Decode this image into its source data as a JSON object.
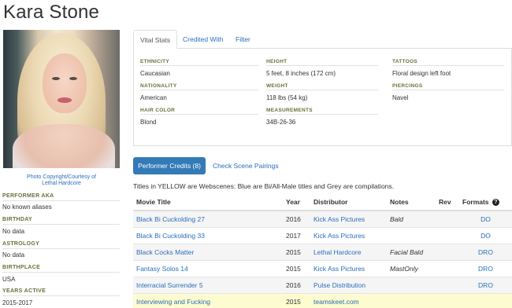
{
  "performer": {
    "name": "Kara Stone",
    "photo_credit_line1": "Photo Copyright/Courtesy of",
    "photo_credit_line2": "Lethal Hardcore"
  },
  "sidebar": [
    {
      "label": "PERFORMER AKA",
      "value": "No known aliases"
    },
    {
      "label": "BIRTHDAY",
      "value": "No data"
    },
    {
      "label": "ASTROLOGY",
      "value": "No data"
    },
    {
      "label": "BIRTHPLACE",
      "value": "USA"
    },
    {
      "label": "YEARS ACTIVE",
      "value": "2015-2017"
    }
  ],
  "tabs": [
    "Vital Stats",
    "Credited With",
    "Filter"
  ],
  "vital_stats": {
    "ethnicity_label": "ETHNICITY",
    "ethnicity": "Caucasian",
    "nationality_label": "NATIONALITY",
    "nationality": "American",
    "hair_label": "HAIR COLOR",
    "hair": "Blond",
    "height_label": "HEIGHT",
    "height": "5 feet, 8 inches (172 cm)",
    "weight_label": "WEIGHT",
    "weight": "118 lbs (54 kg)",
    "measurements_label": "MEASUREMENTS",
    "measurements": "34B-26-36",
    "tattoos_label": "TATTOOS",
    "tattoos": "Floral design left foot",
    "piercings_label": "PIERCINGS",
    "piercings": "Navel"
  },
  "credits": {
    "performer_credits_button": "Performer Credits (8)",
    "scene_pairings_link": "Check Scene Pairings",
    "legend_note": "Titles in YELLOW are Webscenes: Blue are Bi/All-Male titles and Grey are compilations.",
    "headers": [
      "Movie Title",
      "Year",
      "Distributor",
      "Notes",
      "Rev",
      "Formats"
    ],
    "rows": [
      {
        "title": "Black Bi Cuckolding 27",
        "year": "2016",
        "distributor": "Kick Ass Pictures",
        "notes": "Bald",
        "rev": "",
        "formats": "DO"
      },
      {
        "title": "Black Bi Cuckolding 33",
        "year": "2017",
        "distributor": "Kick Ass Pictures",
        "notes": "",
        "rev": "",
        "formats": "DO"
      },
      {
        "title": "Black Cocks Matter",
        "year": "2015",
        "distributor": "Lethal Hardcore",
        "notes": "Facial Bald",
        "rev": "",
        "formats": "DRO"
      },
      {
        "title": "Fantasy Solos 14",
        "year": "2015",
        "distributor": "Kick Ass Pictures",
        "notes": "MastOnly",
        "rev": "",
        "formats": "DRO"
      },
      {
        "title": "Interracial Surrender 5",
        "year": "2016",
        "distributor": "Pulse Distribution",
        "notes": "",
        "rev": "",
        "formats": "DRO"
      },
      {
        "title": "Interviewing and Fucking",
        "year": "2015",
        "distributor": "teamskeet.com",
        "notes": "",
        "rev": "",
        "formats": ""
      }
    ]
  }
}
